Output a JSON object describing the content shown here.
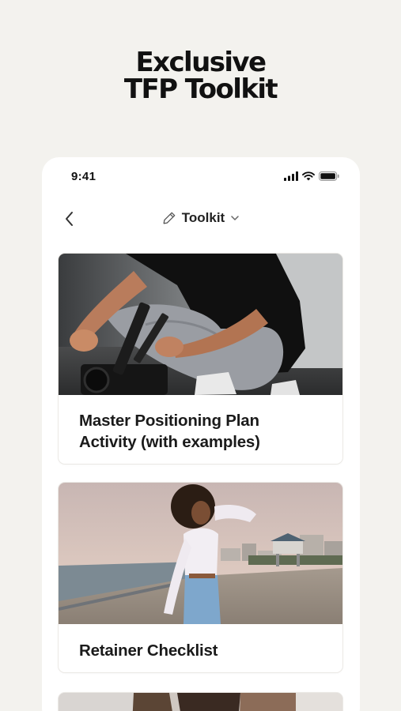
{
  "headline": {
    "line1": "Exclusive",
    "line2": "TFP Toolkit"
  },
  "status_bar": {
    "time": "9:41"
  },
  "nav": {
    "title": "Toolkit"
  },
  "cards": [
    {
      "title_line1": "Master Positioning Plan",
      "title_line2": "Activity (with examples)"
    },
    {
      "title": "Retainer Checklist"
    }
  ],
  "colors": {
    "background": "#f3f2ee",
    "card": "#ffffff",
    "text": "#111111"
  }
}
